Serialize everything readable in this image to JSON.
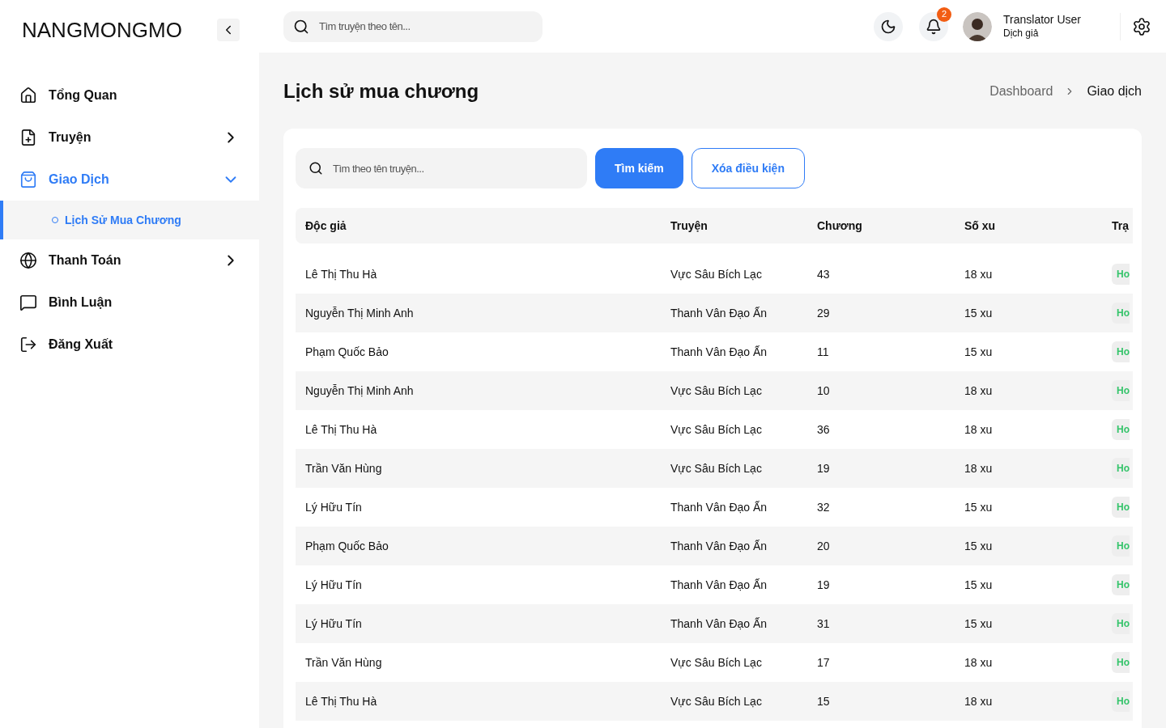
{
  "sidebar": {
    "logo": "NANGMONGMO",
    "items": [
      {
        "kind": "home",
        "label": "Tổng Quan",
        "selected": false
      },
      {
        "kind": "file",
        "label": "Truyện",
        "selected": false,
        "expanded": false
      },
      {
        "kind": "bag",
        "label": "Giao Dịch",
        "selected": true,
        "expanded": true,
        "children": [
          {
            "label": "Lịch Sử Mua Chương",
            "selected": true
          }
        ]
      },
      {
        "kind": "globe",
        "label": "Thanh Toán",
        "selected": false,
        "expanded": false
      },
      {
        "kind": "chat",
        "label": "Bình Luận",
        "selected": false
      },
      {
        "kind": "logout",
        "label": "Đăng Xuất",
        "selected": false
      }
    ]
  },
  "header": {
    "search": {
      "placeholder": "Tìm truyện theo tên..."
    },
    "notifications": "2",
    "user": {
      "name": "Translator User",
      "role": "Dịch giả"
    }
  },
  "page": {
    "title": "Lịch sử mua chương",
    "breadcrumb": [
      "Dashboard",
      "Giao dịch"
    ]
  },
  "filter": {
    "search": {
      "placeholder": "Tìm theo tên truyện..."
    },
    "buttons": [
      "Tìm kiếm",
      "Xóa điều kiện"
    ]
  },
  "table": {
    "columns": [
      "Độc giả",
      "Truyện",
      "Chương",
      "Số xu",
      "Trạ"
    ],
    "rows": [
      [
        "Lê Thị Thu Hà",
        "Vực Sâu Bích Lạc",
        "43",
        "18 xu",
        "Ho"
      ],
      [
        "Nguyễn Thị Minh Anh",
        "Thanh Vân Đạo Ấn",
        "29",
        "15 xu",
        "Ho"
      ],
      [
        "Phạm Quốc Bảo",
        "Thanh Vân Đạo Ấn",
        "11",
        "15 xu",
        "Ho"
      ],
      [
        "Nguyễn Thị Minh Anh",
        "Vực Sâu Bích Lạc",
        "10",
        "18 xu",
        "Ho"
      ],
      [
        "Lê Thị Thu Hà",
        "Vực Sâu Bích Lạc",
        "36",
        "18 xu",
        "Ho"
      ],
      [
        "Trần Văn Hùng",
        "Vực Sâu Bích Lạc",
        "19",
        "18 xu",
        "Ho"
      ],
      [
        "Lý Hữu Tín",
        "Thanh Vân Đạo Ấn",
        "32",
        "15 xu",
        "Ho"
      ],
      [
        "Phạm Quốc Bảo",
        "Thanh Vân Đạo Ấn",
        "20",
        "15 xu",
        "Ho"
      ],
      [
        "Lý Hữu Tín",
        "Thanh Vân Đạo Ấn",
        "19",
        "15 xu",
        "Ho"
      ],
      [
        "Lý Hữu Tín",
        "Thanh Vân Đạo Ấn",
        "31",
        "15 xu",
        "Ho"
      ],
      [
        "Trần Văn Hùng",
        "Vực Sâu Bích Lạc",
        "17",
        "18 xu",
        "Ho"
      ],
      [
        "Lê Thị Thu Hà",
        "Vực Sâu Bích Lạc",
        "15",
        "18 xu",
        "Ho"
      ]
    ]
  }
}
